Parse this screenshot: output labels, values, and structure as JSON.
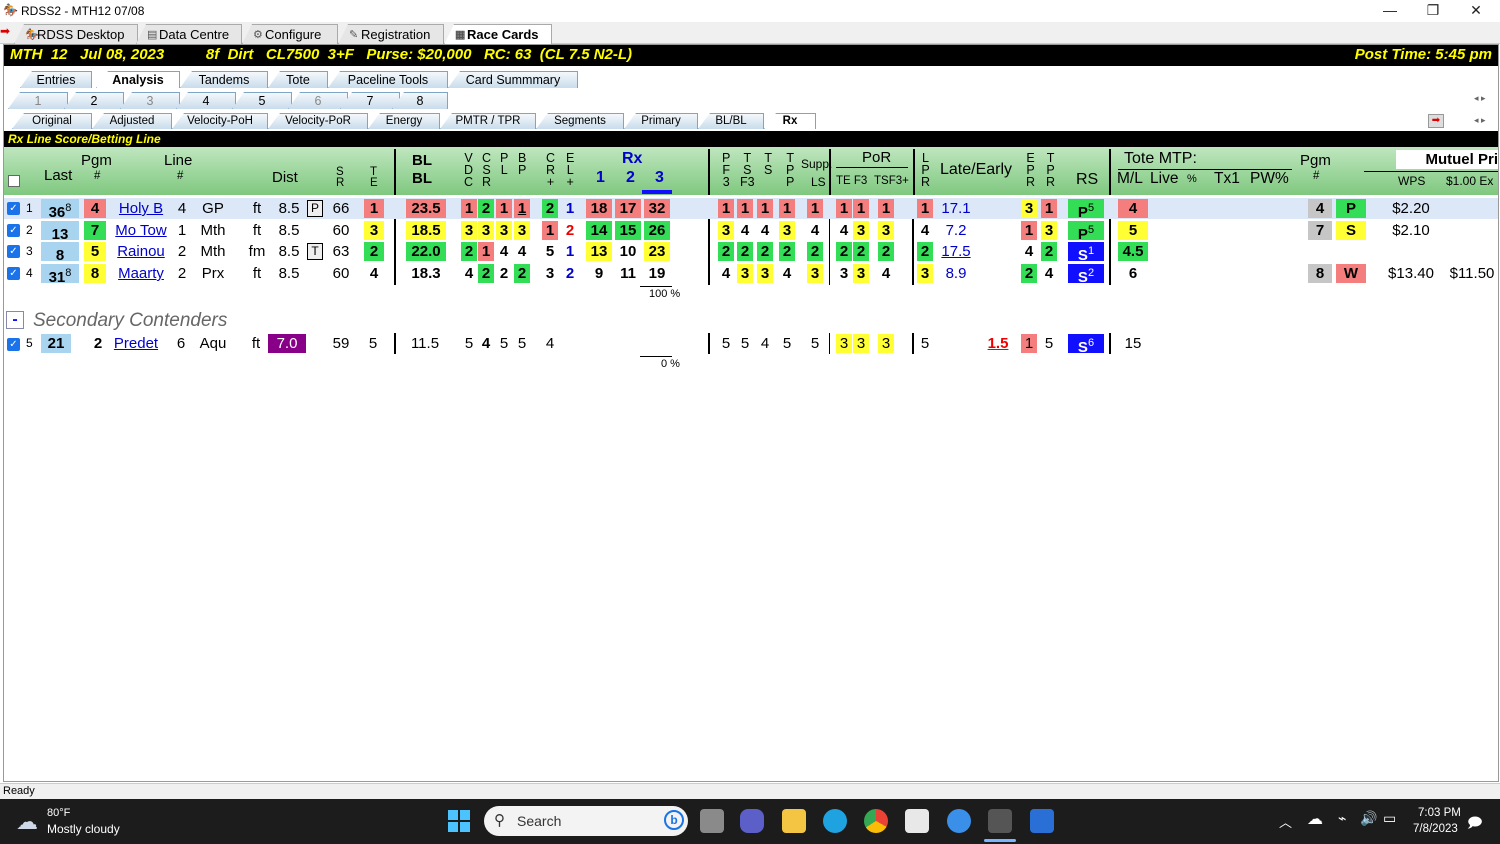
{
  "window": {
    "title": "RDSS2 - MTH12  07/08",
    "min": "—",
    "max": "❐",
    "close": "✕"
  },
  "apptabs": [
    {
      "label": "RDSS Desktop"
    },
    {
      "label": "Data Centre"
    },
    {
      "label": "Configure"
    },
    {
      "label": "Registration"
    },
    {
      "label": "Race Cards"
    }
  ],
  "info": {
    "left": "MTH  12   Jul 08, 2023          8f  Dirt   CL7500  3+F   Purse: $20,000   RC: 63  (CL 7.5 N2-L)",
    "right": "Post Time: 5:45 pm"
  },
  "tabs1": [
    "Entries",
    "Analysis",
    "Tandems",
    "Tote",
    "Paceline Tools",
    "Card Summmary"
  ],
  "tabs2": [
    "1",
    "2",
    "3",
    "4",
    "5",
    "6",
    "7",
    "8"
  ],
  "tabs3": [
    "Original",
    "Adjusted",
    "Velocity-PoH",
    "Velocity-PoR",
    "Energy",
    "PMTR / TPR",
    "Segments",
    "Primary",
    "BL/BL",
    "Rx"
  ],
  "section_title": "Rx Line Score/Betting Line",
  "hdr": {
    "last": "Last",
    "pgm": "Pgm",
    "hash": "#",
    "line": "Line",
    "dist": "Dist",
    "s": "S",
    "r": "R",
    "t": "T",
    "e": "E",
    "bl1": "BL",
    "bl2": "BL",
    "v": "V",
    "d": "D",
    "c1": "C",
    "cs": "S",
    "cr": "R",
    "p": "P",
    "pl": "L",
    "b": "B",
    "bp": "P",
    "cc": "C",
    "ccr": "R",
    "plus1": "+",
    "ee": "E",
    "el": "L",
    "plus2": "+",
    "rx": "Rx",
    "rx1": "1",
    "rx2": "2",
    "rx3": "3",
    "pf": "P",
    "f": "F",
    "f3": "3",
    "tt": "T",
    "ts": "S",
    "tf3": "F3",
    "t2": "T",
    "s2": "S",
    "tp": "T",
    "tpp": "P",
    "tpp2": "P",
    "supp": "Supp.",
    "ls": "LS",
    "por": "PoR",
    "tef3": "TE F3",
    "tsf3": "TSF3+",
    "lp": "L",
    "lpp": "P",
    "lpr": "R",
    "late": "Late/Early",
    "ep": "E",
    "epp": "P",
    "epr": "R",
    "tp2": "T",
    "tpp3": "P",
    "tpr": "R",
    "rs": "RS",
    "tote": "Tote MTP:",
    "ml": "M/L",
    "live": "Live",
    "pct": "%",
    "tx1": "Tx1",
    "pw": "PW%",
    "pgm2": "Pgm",
    "hash2": "#",
    "mutuel": "Mutuel Pri",
    "wps": "WPS",
    "ex": "$1.00 Ex"
  },
  "rows": [
    {
      "n": "1",
      "last": "36",
      "sup": "8",
      "pgm": "4",
      "name": "Holy B",
      "line": "4",
      "trk": "GP",
      "surf": "ft",
      "dist": "8.5",
      "dbox": "P",
      "sr": "66",
      "te": "1",
      "bl": "23.5",
      "v": "1",
      "cs": "2",
      "pl": "1",
      "bp": "1",
      "cr": "2",
      "el": "1",
      "rx1": "18",
      "rx2": "17",
      "rx3": "32",
      "pf": "1",
      "tt": "1",
      "ts": "1",
      "tp": "1",
      "supp": "1",
      "te3": "1",
      "tef": "1",
      "tsf": "1",
      "lp": "1",
      "late": "17.1",
      "ep": "3",
      "tpr": "1",
      "rs": "P",
      "rssup": "5",
      "ml": "4",
      "mpgm": "4",
      "fin": "P",
      "wps": "$2.20",
      "ex": ""
    },
    {
      "n": "2",
      "last": "13",
      "sup": "",
      "pgm": "7",
      "name": "Mo Tow",
      "line": "1",
      "trk": "Mth",
      "surf": "ft",
      "dist": "8.5",
      "dbox": "",
      "sr": "60",
      "te": "3",
      "bl": "18.5",
      "v": "3",
      "cs": "3",
      "pl": "3",
      "bp": "3",
      "cr": "1",
      "el": "2",
      "rx1": "14",
      "rx2": "15",
      "rx3": "26",
      "pf": "3",
      "tt": "4",
      "ts": "4",
      "tp": "3",
      "supp": "4",
      "te3": "4",
      "tef": "3",
      "tsf": "3",
      "lp": "4",
      "late": "7.2",
      "ep": "1",
      "tpr": "3",
      "rs": "P",
      "rssup": "5",
      "ml": "5",
      "mpgm": "7",
      "fin": "S",
      "wps": "$2.10",
      "ex": ""
    },
    {
      "n": "3",
      "last": "8",
      "sup": "",
      "pgm": "5",
      "name": "Rainou",
      "line": "2",
      "trk": "Mth",
      "surf": "fm",
      "dist": "8.5",
      "dbox": "T",
      "sr": "63",
      "te": "2",
      "bl": "22.0",
      "v": "2",
      "cs": "1",
      "pl": "4",
      "bp": "4",
      "cr": "5",
      "el": "1",
      "rx1": "13",
      "rx2": "10",
      "rx3": "23",
      "pf": "2",
      "tt": "2",
      "ts": "2",
      "tp": "2",
      "supp": "2",
      "te3": "2",
      "tef": "2",
      "tsf": "2",
      "lp": "2",
      "late": "17.5",
      "ep": "4",
      "tpr": "2",
      "rs": "S",
      "rssup": "1",
      "ml": "4.5",
      "mpgm": "",
      "fin": "",
      "wps": "",
      "ex": ""
    },
    {
      "n": "4",
      "last": "31",
      "sup": "8",
      "pgm": "8",
      "name": "Maarty",
      "line": "2",
      "trk": "Prx",
      "surf": "ft",
      "dist": "8.5",
      "dbox": "",
      "sr": "60",
      "te": "4",
      "bl": "18.3",
      "v": "4",
      "cs": "2",
      "pl": "2",
      "bp": "2",
      "cr": "3",
      "el": "2",
      "rx1": "9",
      "rx2": "11",
      "rx3": "19",
      "pf": "4",
      "tt": "3",
      "ts": "3",
      "tp": "4",
      "supp": "3",
      "te3": "3",
      "tef": "3",
      "tsf": "4",
      "lp": "3",
      "late": "8.9",
      "ep": "2",
      "tpr": "4",
      "rs": "S",
      "rssup": "2",
      "ml": "6",
      "mpgm": "8",
      "fin": "W",
      "wps": "$13.40",
      "ex": "$11.50"
    }
  ],
  "pct1": "100 %",
  "secondary": {
    "minus": "-",
    "label": "Secondary Contenders"
  },
  "row5": {
    "n": "5",
    "last": "21",
    "pgm": "2",
    "name": "Predet",
    "line": "6",
    "trk": "Aqu",
    "surf": "ft",
    "dist": "7.0",
    "sr": "59",
    "te": "5",
    "bl": "11.5",
    "v": "5",
    "cs": "4",
    "pl": "5",
    "bp": "5",
    "cr": "4",
    "pf": "5",
    "tt": "5",
    "ts": "4",
    "tp": "5",
    "supp": "5",
    "te3": "3",
    "tef": "3",
    "tsf": "3",
    "lp": "5",
    "late": "1.5",
    "ep": "1",
    "tpr": "5",
    "rs": "S",
    "rssup": "6",
    "ml": "15"
  },
  "pct2": "0 %",
  "status": "Ready",
  "taskbar": {
    "temp": "80°F",
    "weather": "Mostly cloudy",
    "search": "Search",
    "time": "7:03 PM",
    "date": "7/8/2023"
  },
  "colors": {
    "yellow": "#ffff33",
    "red": "#f47e7e",
    "green": "#33dd55",
    "blue": "#1010ff"
  }
}
